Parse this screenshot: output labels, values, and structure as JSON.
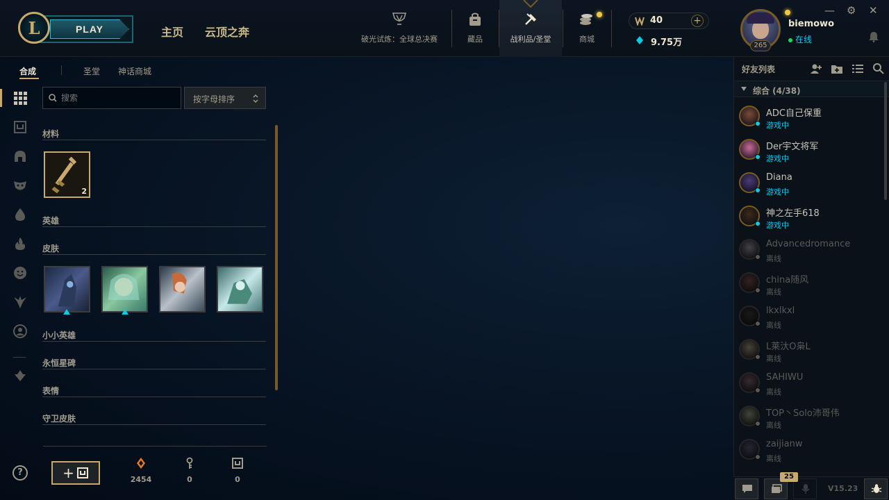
{
  "topbar": {
    "play_label": "PLAY",
    "nav_home": "主页",
    "nav_tft": "云顶之奔",
    "icons": [
      {
        "label": "破光试炼：全球总决赛",
        "icon": "worlds-trophy-icon"
      },
      {
        "label": "藏品",
        "icon": "collection-bag-icon"
      },
      {
        "label": "战利品/圣堂",
        "icon": "loot-hammer-icon"
      },
      {
        "label": "商城",
        "icon": "store-coins-icon"
      }
    ],
    "rp": "40",
    "be": "9.75万"
  },
  "user": {
    "name": "biemowo",
    "status": "在线",
    "level": "265"
  },
  "left": {
    "tabs": [
      "合成",
      "圣堂",
      "神话商城"
    ],
    "search_placeholder": "搜索",
    "sort_label": "按字母排序",
    "categories": [
      "材料",
      "英雄",
      "皮肤",
      "小小英雄",
      "永恒星碑",
      "表情",
      "守卫皮肤"
    ],
    "key_count": "2",
    "resources": [
      {
        "icon": "orange-essence-icon",
        "value": "2454"
      },
      {
        "icon": "key-fragment-icon",
        "value": "0"
      },
      {
        "icon": "chest-icon",
        "value": "0"
      }
    ]
  },
  "friends": {
    "title": "好友列表",
    "group": "综合 (4/38)",
    "list": [
      {
        "name": "ADC自己保重",
        "status": "游戏中",
        "online": true,
        "color": "#7a4a3a"
      },
      {
        "name": "Der宇文将军",
        "status": "游戏中",
        "online": true,
        "color": "#c86a9a"
      },
      {
        "name": "Diana",
        "status": "游戏中",
        "online": true,
        "color": "#4a3a7a"
      },
      {
        "name": "神之左手618",
        "status": "游戏中",
        "online": true,
        "color": "#3a2a1a"
      },
      {
        "name": "Advancedromance",
        "status": "离线",
        "online": false,
        "color": "#6a6a8a"
      },
      {
        "name": "china随风",
        "status": "离线",
        "online": false,
        "color": "#8a2a2a"
      },
      {
        "name": "lkxlkxl",
        "status": "离线",
        "online": false,
        "color": "#2a2a2a"
      },
      {
        "name": "L莱汏O枭L",
        "status": "离线",
        "online": false,
        "color": "#8a6a3a"
      },
      {
        "name": "SAHIWU",
        "status": "离线",
        "online": false,
        "color": "#7a3a5a"
      },
      {
        "name": "TOP丶Solo沛哥伟",
        "status": "离线",
        "online": false,
        "color": "#5a7a3a"
      },
      {
        "name": "zaijianw",
        "status": "离线",
        "online": false,
        "color": "#3a3a8a"
      }
    ],
    "badge": "25",
    "version": "V15.23"
  }
}
